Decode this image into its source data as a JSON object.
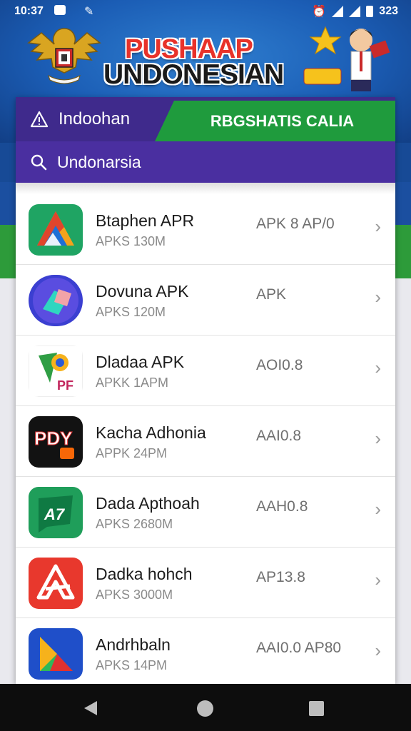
{
  "status_bar": {
    "time": "10:37",
    "right_text": "323"
  },
  "banner": {
    "line1": "PUSHAAP",
    "line2": "UNDONESIAN"
  },
  "tabs": {
    "left_label": "Indoohan",
    "right_label": "RBGSHATIS CALIA"
  },
  "search": {
    "text": "Undonarsia"
  },
  "apps": [
    {
      "name": "Btaphen APR",
      "sub": "APKS 130M",
      "version": "APK 8 AP/0",
      "icon": "drive-triangle-icon"
    },
    {
      "name": "Dovuna APK",
      "sub": "APKS 120M",
      "version": "APK",
      "icon": "eraser-icon"
    },
    {
      "name": "Dladaa APK",
      "sub": "APKK 1APM",
      "version": "AOI0.8",
      "icon": "pf-maps-icon"
    },
    {
      "name": "Kacha Adhonia",
      "sub": "APPK 24PM",
      "version": "AAI0.8",
      "icon": "pdx-icon"
    },
    {
      "name": "Dada Apthoah",
      "sub": "APKS 2680M",
      "version": "AAH0.8",
      "icon": "a7-chat-icon"
    },
    {
      "name": "Dadka hohch",
      "sub": "APKS 3000M",
      "version": "AP13.8",
      "icon": "red-a-icon"
    },
    {
      "name": "Andrhbaln",
      "sub": "APKS 14PM",
      "version": "AAI0.0 AP80",
      "icon": "play-triangle-icon"
    }
  ],
  "colors": {
    "tab_purple": "#3f2a8c",
    "tab_green": "#1f9b3d",
    "search_purple": "#4a2fa0"
  }
}
